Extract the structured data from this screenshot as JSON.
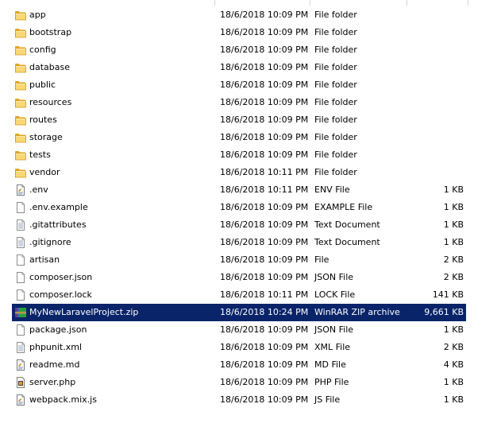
{
  "files": [
    {
      "name": "app",
      "date": "18/6/2018 10:09 PM",
      "type": "File folder",
      "size": "",
      "icon": "folder-icon"
    },
    {
      "name": "bootstrap",
      "date": "18/6/2018 10:09 PM",
      "type": "File folder",
      "size": "",
      "icon": "folder-icon"
    },
    {
      "name": "config",
      "date": "18/6/2018 10:09 PM",
      "type": "File folder",
      "size": "",
      "icon": "folder-icon"
    },
    {
      "name": "database",
      "date": "18/6/2018 10:09 PM",
      "type": "File folder",
      "size": "",
      "icon": "folder-icon"
    },
    {
      "name": "public",
      "date": "18/6/2018 10:09 PM",
      "type": "File folder",
      "size": "",
      "icon": "folder-icon"
    },
    {
      "name": "resources",
      "date": "18/6/2018 10:09 PM",
      "type": "File folder",
      "size": "",
      "icon": "folder-icon"
    },
    {
      "name": "routes",
      "date": "18/6/2018 10:09 PM",
      "type": "File folder",
      "size": "",
      "icon": "folder-icon"
    },
    {
      "name": "storage",
      "date": "18/6/2018 10:09 PM",
      "type": "File folder",
      "size": "",
      "icon": "folder-icon"
    },
    {
      "name": "tests",
      "date": "18/6/2018 10:09 PM",
      "type": "File folder",
      "size": "",
      "icon": "folder-icon"
    },
    {
      "name": "vendor",
      "date": "18/6/2018 10:11 PM",
      "type": "File folder",
      "size": "",
      "icon": "folder-icon"
    },
    {
      "name": ".env",
      "date": "18/6/2018 10:11 PM",
      "type": "ENV File",
      "size": "1 KB",
      "icon": "text-file-icon"
    },
    {
      "name": ".env.example",
      "date": "18/6/2018 10:09 PM",
      "type": "EXAMPLE File",
      "size": "1 KB",
      "icon": "blank-file-icon"
    },
    {
      "name": ".gitattributes",
      "date": "18/6/2018 10:09 PM",
      "type": "Text Document",
      "size": "1 KB",
      "icon": "text-document-icon"
    },
    {
      "name": ".gitignore",
      "date": "18/6/2018 10:09 PM",
      "type": "Text Document",
      "size": "1 KB",
      "icon": "text-document-icon"
    },
    {
      "name": "artisan",
      "date": "18/6/2018 10:09 PM",
      "type": "File",
      "size": "2 KB",
      "icon": "blank-file-icon"
    },
    {
      "name": "composer.json",
      "date": "18/6/2018 10:09 PM",
      "type": "JSON File",
      "size": "2 KB",
      "icon": "blank-file-icon"
    },
    {
      "name": "composer.lock",
      "date": "18/6/2018 10:11 PM",
      "type": "LOCK File",
      "size": "141 KB",
      "icon": "blank-file-icon"
    },
    {
      "name": "MyNewLaravelProject.zip",
      "date": "18/6/2018 10:24 PM",
      "type": "WinRAR ZIP archive",
      "size": "9,661 KB",
      "icon": "winrar-archive-icon",
      "selected": true
    },
    {
      "name": "package.json",
      "date": "18/6/2018 10:09 PM",
      "type": "JSON File",
      "size": "1 KB",
      "icon": "blank-file-icon"
    },
    {
      "name": "phpunit.xml",
      "date": "18/6/2018 10:09 PM",
      "type": "XML File",
      "size": "2 KB",
      "icon": "text-document-icon"
    },
    {
      "name": "readme.md",
      "date": "18/6/2018 10:09 PM",
      "type": "MD File",
      "size": "4 KB",
      "icon": "text-file-icon"
    },
    {
      "name": "server.php",
      "date": "18/6/2018 10:09 PM",
      "type": "PHP File",
      "size": "1 KB",
      "icon": "php-file-icon"
    },
    {
      "name": "webpack.mix.js",
      "date": "18/6/2018 10:09 PM",
      "type": "JS File",
      "size": "1 KB",
      "icon": "text-file-icon"
    }
  ]
}
